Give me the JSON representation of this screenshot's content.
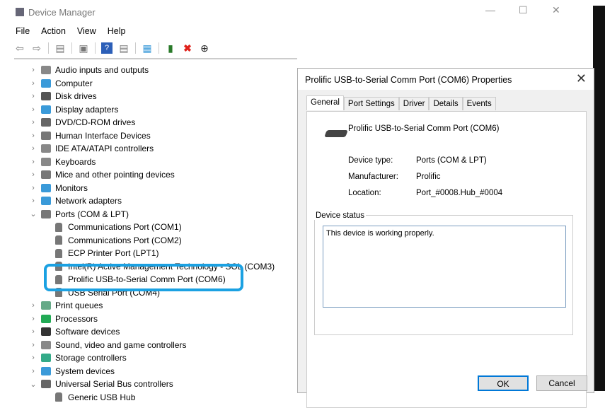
{
  "window": {
    "title": "Device Manager",
    "minimize": "—",
    "maximize": "☐",
    "close": "✕"
  },
  "menu": [
    "File",
    "Action",
    "View",
    "Help"
  ],
  "toolbar": {
    "icons": [
      "back-icon",
      "forward-icon",
      "properties-icon",
      "update-icon",
      "help-icon",
      "view-icon",
      "monitor-icon",
      "add-driver-icon",
      "uninstall-icon",
      "download-icon"
    ]
  },
  "tree": {
    "top": [
      "Audio inputs and outputs",
      "Computer",
      "Disk drives",
      "Display adapters",
      "DVD/CD-ROM drives",
      "Human Interface Devices",
      "IDE ATA/ATAPI controllers",
      "Keyboards",
      "Mice and other pointing devices",
      "Monitors",
      "Network adapters"
    ],
    "ports": {
      "label": "Ports (COM & LPT)",
      "children": [
        "Communications Port (COM1)",
        "Communications Port (COM2)",
        "ECP Printer Port (LPT1)",
        "Intel(R) Active Management Technology - SOL (COM3)",
        "Prolific USB-to-Serial Comm Port (COM6)",
        "USB Serial Port (COM4)"
      ]
    },
    "bottom": [
      "Print queues",
      "Processors",
      "Software devices",
      "Sound, video and game controllers",
      "Storage controllers",
      "System devices"
    ],
    "usb": {
      "label": "Universal Serial Bus controllers",
      "children": [
        "Generic USB Hub"
      ]
    },
    "highlight_color": "#1ba1e2"
  },
  "dialog": {
    "title": "Prolific USB-to-Serial Comm Port (COM6) Properties",
    "close": "✕",
    "tabs": [
      "General",
      "Port Settings",
      "Driver",
      "Details",
      "Events"
    ],
    "device_name": "Prolific USB-to-Serial Comm Port (COM6)",
    "fields": [
      {
        "label": "Device type:",
        "value": "Ports (COM & LPT)"
      },
      {
        "label": "Manufacturer:",
        "value": "Prolific"
      },
      {
        "label": "Location:",
        "value": "Port_#0008.Hub_#0004"
      }
    ],
    "status_label": "Device status",
    "status_text": "This device is working properly.",
    "ok": "OK",
    "cancel": "Cancel"
  }
}
